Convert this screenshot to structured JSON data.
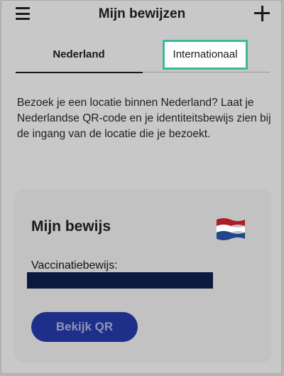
{
  "header": {
    "title": "Mijn bewijzen",
    "menu_icon": "hamburger-menu-icon",
    "add_icon": "plus-icon"
  },
  "tabs": [
    {
      "label": "Nederland",
      "selected": true
    },
    {
      "label": "Internationaal",
      "selected": false,
      "highlighted": true
    }
  ],
  "description": "Bezoek je een locatie binnen Nederland? Laat je Nederlandse QR-code en je identiteitsbewijs zien bij de ingang van de locatie die je bezoekt.",
  "card": {
    "title": "Mijn bewijs",
    "flag_icon": "netherlands-flag-icon",
    "certificate_label": "Vaccinatiebewijs:",
    "button_label": "Bekijk QR"
  },
  "colors": {
    "highlight_border": "#3cb99b",
    "button_background": "#1e2f8a",
    "flag_red": "#ae1c28",
    "flag_white": "#ffffff",
    "flag_blue": "#21468b",
    "redaction": "#0b1840"
  }
}
